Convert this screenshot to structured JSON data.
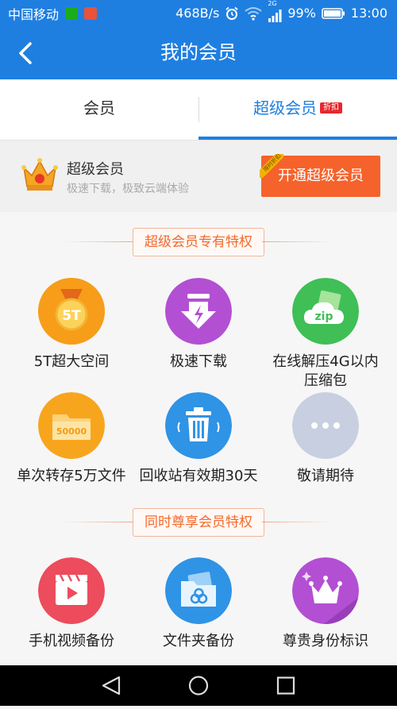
{
  "status_bar": {
    "carrier": "中国移动",
    "speed": "468B/s",
    "network": "2G",
    "battery": "99%",
    "time": "13:00"
  },
  "header": {
    "title": "我的会员",
    "back_icon": "chevron-left-icon"
  },
  "tabs": [
    {
      "label": "会员",
      "active": false
    },
    {
      "label": "超级会员",
      "active": true,
      "badge": "折扣"
    }
  ],
  "banner": {
    "title": "超级会员",
    "subtitle": "极速下载，极致云端体验",
    "button_label": "开通超级会员",
    "ribbon": "限时折扣"
  },
  "super_section": {
    "heading": "超级会员专有特权",
    "features": [
      {
        "label": "5T超大空间",
        "icon": "5t-medal-icon",
        "icon_text": "5T",
        "color": "#f7a21b"
      },
      {
        "label": "极速下载",
        "icon": "fast-download-icon",
        "color": "#b34fd3"
      },
      {
        "label": "在线解压4G以内压缩包",
        "label_line1": "在线解压4G以内",
        "label_line2": "压缩包",
        "icon": "zip-cloud-icon",
        "icon_text": "zip",
        "color": "#3fbf56"
      },
      {
        "label": "单次转存5万文件",
        "icon": "folder-50000-icon",
        "icon_text": "50000",
        "color": "#f7a21b"
      },
      {
        "label": "回收站有效期30天",
        "icon": "trash-icon",
        "color": "#2f93e6"
      },
      {
        "label": "敬请期待",
        "icon": "more-dots-icon",
        "color": "#c8cfe0"
      }
    ]
  },
  "shared_section": {
    "heading": "同时尊享会员特权",
    "features": [
      {
        "label": "手机视频备份",
        "icon": "video-clapper-icon",
        "color": "#ec4c5c"
      },
      {
        "label": "文件夹备份",
        "icon": "folder-backup-icon",
        "color": "#2f93e6"
      },
      {
        "label": "尊贵身份标识",
        "icon": "crown-badge-icon",
        "color": "#b34fd3"
      }
    ]
  },
  "nav_bar": {
    "back": "nav-back-icon",
    "home": "nav-home-icon",
    "recents": "nav-recents-icon"
  }
}
